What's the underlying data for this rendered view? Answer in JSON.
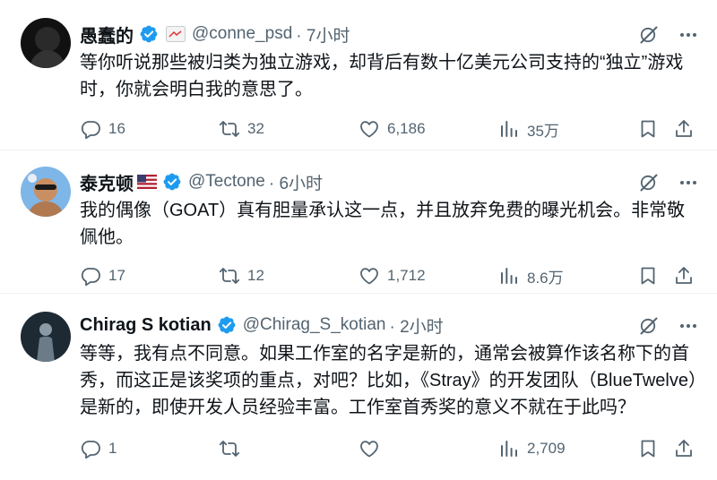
{
  "tweets": [
    {
      "name": "愚蠢的",
      "handle": "@conne_psd",
      "time": "· 7小时",
      "text": "等你听说那些被归类为独立游戏，却背后有数十亿美元公司支持的“独立”游戏时，你就会明白我的意思了。",
      "replies": "16",
      "retweets": "32",
      "likes": "6,186",
      "views": "35万"
    },
    {
      "name": "泰克顿",
      "handle": "@Tectone",
      "time": "· 6小时",
      "text": "我的偶像（GOAT）真有胆量承认这一点，并且放弃免费的曝光机会。非常敬佩他。",
      "replies": "17",
      "retweets": "12",
      "likes": "1,712",
      "views": "8.6万"
    },
    {
      "name": "Chirag S kotian",
      "handle": "@Chirag_S_kotian",
      "time": "· 2小时",
      "text": "等等，我有点不同意。如果工作室的名字是新的，通常会被算作该名称下的首秀，而这正是该奖项的重点，对吧？比如，《Stray》的开发团队（BlueTwelve）是新的，即使开发人员经验丰富。工作室首秀奖的意义不就在于此吗？",
      "replies": "1",
      "retweets": "",
      "likes": "",
      "views": "2,709"
    }
  ],
  "colors": {
    "verified": "#1d9bf0",
    "muted": "#536471",
    "text": "#0f1419"
  },
  "icons": [
    "reply-icon",
    "retweet-icon",
    "like-icon",
    "views-icon",
    "bookmark-icon",
    "share-icon",
    "grok-icon",
    "more-icon",
    "verified-icon",
    "flag-icon"
  ]
}
